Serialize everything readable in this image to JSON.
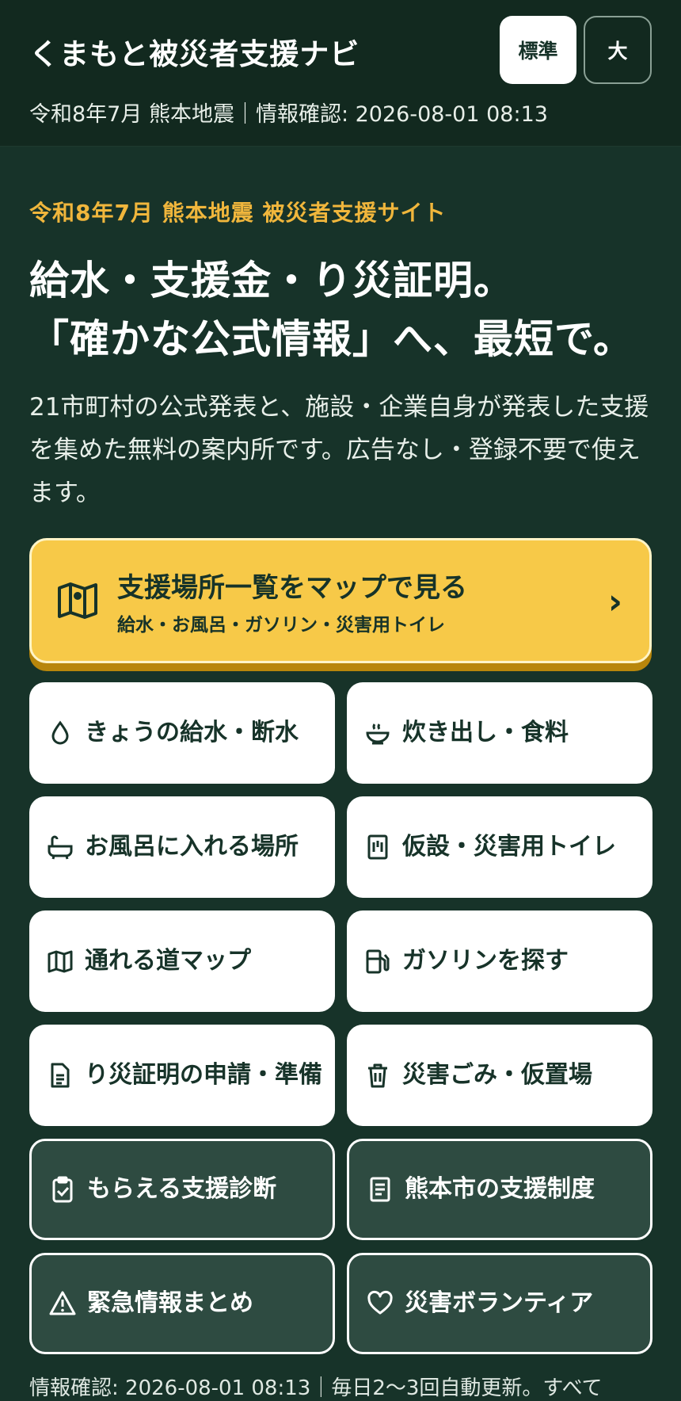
{
  "header": {
    "title": "くまもと被災者支援ナビ",
    "size_standard": "標準",
    "size_large": "大",
    "subline": "令和8年7月 熊本地震｜情報確認: 2026-08-01 08:13"
  },
  "hero": {
    "kicker": "令和8年7月 熊本地震 被災者支援サイト",
    "headline_line1": "給水・支援金・り災証明。",
    "headline_line2": "「確かな公式情報」へ、最短で。",
    "lead": "21市町村の公式発表と、施設・企業自身が発表した支援を集めた無料の案内所です。広告なし・登録不要で使えます。"
  },
  "cta": {
    "title": "支援場所一覧をマップで見る",
    "subtitle": "給水・お風呂・ガソリン・災害用トイレ",
    "chevron": "›",
    "icon": "map-icon"
  },
  "tiles": [
    {
      "label": "きょうの給水・断水",
      "icon": "water-drop-icon",
      "style": "light"
    },
    {
      "label": "炊き出し・食料",
      "icon": "food-bowl-icon",
      "style": "light"
    },
    {
      "label": "お風呂に入れる場所",
      "icon": "bathtub-icon",
      "style": "light"
    },
    {
      "label": "仮設・災害用トイレ",
      "icon": "toilet-icon",
      "style": "light"
    },
    {
      "label": "通れる道マップ",
      "icon": "road-map-icon",
      "style": "light"
    },
    {
      "label": "ガソリンを探す",
      "icon": "fuel-icon",
      "style": "light"
    },
    {
      "label": "り災証明の申請・準備",
      "icon": "document-icon",
      "style": "light"
    },
    {
      "label": "災害ごみ・仮置場",
      "icon": "trash-icon",
      "style": "light"
    },
    {
      "label": "もらえる支援診断",
      "icon": "clipboard-check-icon",
      "style": "dark"
    },
    {
      "label": "熊本市の支援制度",
      "icon": "document-list-icon",
      "style": "dark"
    },
    {
      "label": "緊急情報まとめ",
      "icon": "warning-icon",
      "style": "dark"
    },
    {
      "label": "災害ボランティア",
      "icon": "heart-icon",
      "style": "dark"
    }
  ],
  "footer": {
    "note": "情報確認: 2026-08-01 08:13｜毎日2〜3回自動更新。すべて"
  },
  "colors": {
    "background": "#173329",
    "accent_yellow": "#f7c948",
    "kicker": "#f0b63c"
  }
}
